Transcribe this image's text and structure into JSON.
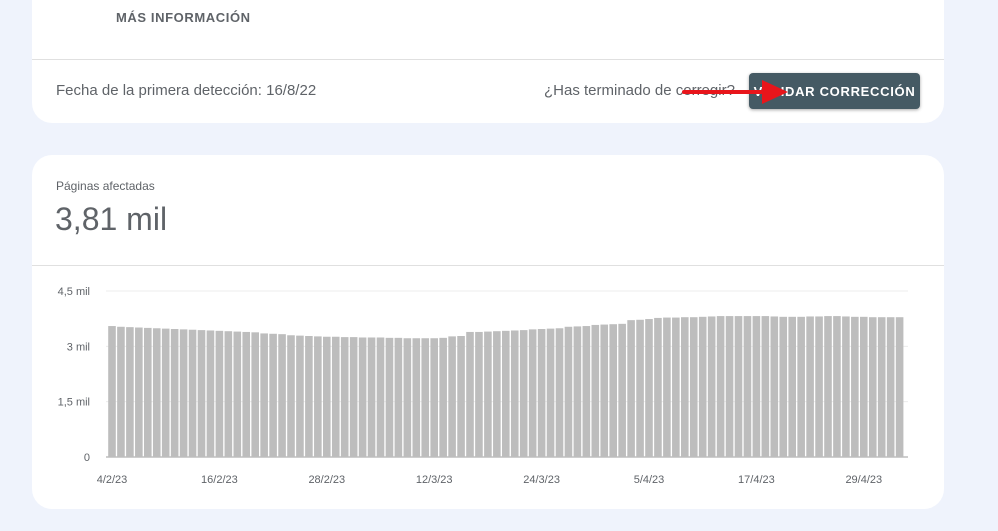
{
  "issue_card": {
    "more_info_label": "MÁS INFORMACIÓN",
    "first_detection": "Fecha de la primera detección: 16/8/22",
    "finished_question": "¿Has terminado de corregir?",
    "validate_button": "VALIDAR CORRECCIÓN"
  },
  "pages_card": {
    "label": "Páginas afectadas",
    "value": "3,81 mil"
  },
  "colors": {
    "bar": "#bdbdbd",
    "button": "#455a64",
    "annotation_arrow": "#e8151b"
  },
  "chart_data": {
    "type": "bar",
    "title": "",
    "xlabel": "",
    "ylabel": "",
    "ylim": [
      0,
      4500
    ],
    "grid": true,
    "y_ticks": [
      {
        "value": 0,
        "label": "0"
      },
      {
        "value": 1500,
        "label": "1,5 mil"
      },
      {
        "value": 3000,
        "label": "3 mil"
      },
      {
        "value": 4500,
        "label": "4,5 mil"
      }
    ],
    "x_tick_labels": [
      {
        "index": 0,
        "label": "4/2/23"
      },
      {
        "index": 12,
        "label": "16/2/23"
      },
      {
        "index": 24,
        "label": "28/2/23"
      },
      {
        "index": 36,
        "label": "12/3/23"
      },
      {
        "index": 48,
        "label": "24/3/23"
      },
      {
        "index": 60,
        "label": "5/4/23"
      },
      {
        "index": 72,
        "label": "17/4/23"
      },
      {
        "index": 84,
        "label": "29/4/23"
      }
    ],
    "categories": [
      "4/2/23",
      "5/2/23",
      "6/2/23",
      "7/2/23",
      "8/2/23",
      "9/2/23",
      "10/2/23",
      "11/2/23",
      "12/2/23",
      "13/2/23",
      "14/2/23",
      "15/2/23",
      "16/2/23",
      "17/2/23",
      "18/2/23",
      "19/2/23",
      "20/2/23",
      "21/2/23",
      "22/2/23",
      "23/2/23",
      "24/2/23",
      "25/2/23",
      "26/2/23",
      "27/2/23",
      "28/2/23",
      "1/3/23",
      "2/3/23",
      "3/3/23",
      "4/3/23",
      "5/3/23",
      "6/3/23",
      "7/3/23",
      "8/3/23",
      "9/3/23",
      "10/3/23",
      "11/3/23",
      "12/3/23",
      "13/3/23",
      "14/3/23",
      "15/3/23",
      "16/3/23",
      "17/3/23",
      "18/3/23",
      "19/3/23",
      "20/3/23",
      "21/3/23",
      "22/3/23",
      "23/3/23",
      "24/3/23",
      "25/3/23",
      "26/3/23",
      "27/3/23",
      "28/3/23",
      "29/3/23",
      "30/3/23",
      "31/3/23",
      "1/4/23",
      "2/4/23",
      "3/4/23",
      "4/4/23",
      "5/4/23",
      "6/4/23",
      "7/4/23",
      "8/4/23",
      "9/4/23",
      "10/4/23",
      "11/4/23",
      "12/4/23",
      "13/4/23",
      "14/4/23",
      "15/4/23",
      "16/4/23",
      "17/4/23",
      "18/4/23",
      "19/4/23",
      "20/4/23",
      "21/4/23",
      "22/4/23",
      "23/4/23",
      "24/4/23",
      "25/4/23",
      "26/4/23",
      "27/4/23",
      "28/4/23",
      "29/4/23",
      "30/4/23",
      "1/5/23",
      "2/5/23",
      "3/5/23"
    ],
    "values": [
      3550,
      3530,
      3520,
      3510,
      3500,
      3490,
      3480,
      3470,
      3460,
      3450,
      3440,
      3430,
      3420,
      3410,
      3400,
      3390,
      3380,
      3350,
      3340,
      3330,
      3300,
      3290,
      3280,
      3270,
      3260,
      3260,
      3250,
      3250,
      3240,
      3240,
      3240,
      3230,
      3230,
      3220,
      3220,
      3220,
      3220,
      3230,
      3270,
      3280,
      3390,
      3390,
      3400,
      3410,
      3420,
      3430,
      3440,
      3460,
      3470,
      3480,
      3490,
      3530,
      3540,
      3550,
      3580,
      3590,
      3600,
      3610,
      3710,
      3720,
      3740,
      3770,
      3780,
      3780,
      3790,
      3790,
      3800,
      3810,
      3820,
      3820,
      3820,
      3820,
      3820,
      3820,
      3810,
      3800,
      3800,
      3800,
      3810,
      3810,
      3820,
      3820,
      3810,
      3800,
      3800,
      3790,
      3790,
      3790,
      3790
    ]
  }
}
